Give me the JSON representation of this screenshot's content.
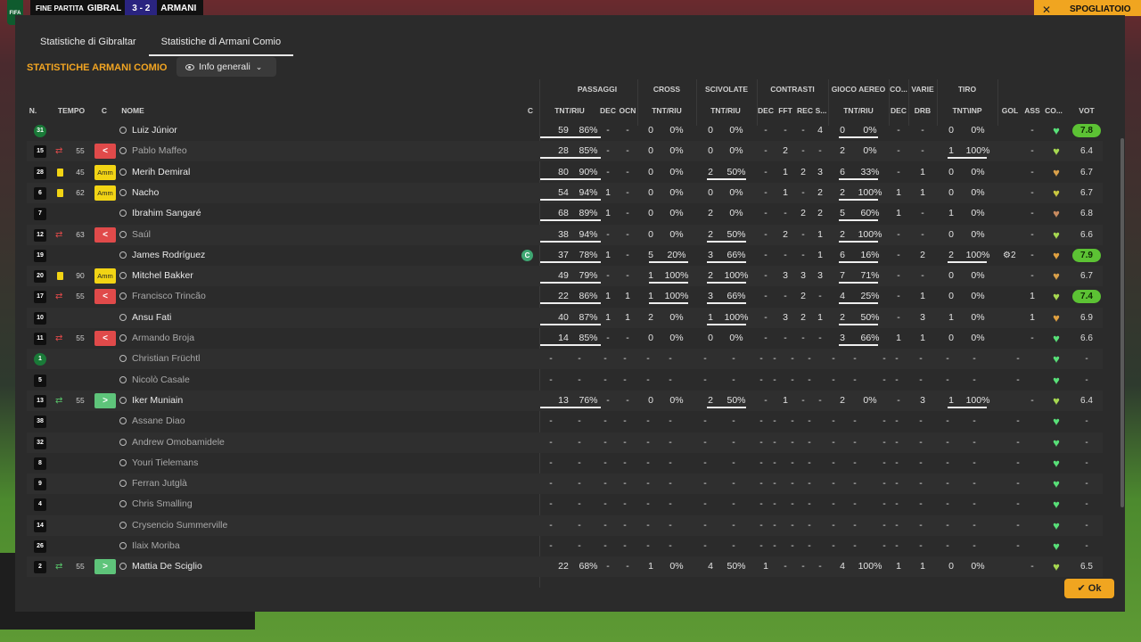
{
  "topbar": {
    "label": "FINE PARTITA",
    "home": "GIBRAL",
    "score": "3 - 2",
    "away": "ARMANI",
    "right": "SPOGLIATOIO",
    "close": "✕",
    "logo": "FIFA"
  },
  "tabs": [
    {
      "label": "Statistiche di Gibraltar"
    },
    {
      "label": "Statistiche di Armani Comio"
    }
  ],
  "team_title": "STATISTICHE ARMANI COMIO",
  "dropdown": {
    "label": "Info generali"
  },
  "groups": [
    "PASSAGGI",
    "CROSS",
    "SCIVOLATE",
    "CONTRASTI",
    "GIOCO AEREO",
    "CO...",
    "VARIE",
    "TIRO"
  ],
  "columns": [
    "N.",
    "TEMPO",
    "C",
    "NOME",
    "C",
    "TNT/RIU",
    "DEC",
    "OCN",
    "TNT/RIU",
    "TNT/RIU",
    "DEC",
    "FFT",
    "REC",
    "S...",
    "TNT/RIU",
    "DEC",
    "DRB",
    "TNT\\INP",
    "GOL",
    "ASS",
    "CO...",
    "VOT"
  ],
  "ok_label": "Ok",
  "colors": {
    "accent": "#f0a520",
    "vote_high": "#5cc234",
    "sub_out": "#e04a4a",
    "sub_in": "#5ec47a",
    "yellow": "#f2d414"
  },
  "players": [
    {
      "n": "31",
      "gk": true,
      "name": "Luiz Júnior",
      "mark": "",
      "min": "",
      "badge": "",
      "p": [
        "59",
        "86%"
      ],
      "pd": "-",
      "po": "-",
      "cr": [
        "0",
        "0%"
      ],
      "sc": [
        "0",
        "0%"
      ],
      "ct": [
        "-",
        "-",
        "-",
        "4"
      ],
      "ae": [
        "0",
        "0%"
      ],
      "co": "-",
      "dr": "-",
      "ti": [
        "0",
        "0%"
      ],
      "gol": "",
      "ass": "-",
      "heart": "#58e078",
      "vote": "7.8",
      "hi": true,
      "sub": false,
      "barp": true,
      "barc": false,
      "bars": false,
      "bara": true,
      "bart": false
    },
    {
      "n": "15",
      "name": "Pablo Maffeo",
      "mark": "out",
      "min": "55",
      "badge": "out",
      "p": [
        "28",
        "85%"
      ],
      "pd": "-",
      "po": "-",
      "cr": [
        "0",
        "0%"
      ],
      "sc": [
        "0",
        "0%"
      ],
      "ct": [
        "-",
        "2",
        "-",
        "-"
      ],
      "ae": [
        "2",
        "0%"
      ],
      "co": "-",
      "dr": "-",
      "ti": [
        "1",
        "100%"
      ],
      "gol": "",
      "ass": "-",
      "heart": "#a6d850",
      "vote": "6.4",
      "hi": false,
      "sub": true,
      "barp": true,
      "barc": false,
      "bars": false,
      "bara": false,
      "bart": true
    },
    {
      "n": "28",
      "name": "Merih Demiral",
      "mark": "yellow",
      "min": "45",
      "badge": "amm",
      "p": [
        "80",
        "90%"
      ],
      "pd": "-",
      "po": "-",
      "cr": [
        "0",
        "0%"
      ],
      "sc": [
        "2",
        "50%"
      ],
      "ct": [
        "-",
        "1",
        "2",
        "3"
      ],
      "ae": [
        "6",
        "33%"
      ],
      "co": "-",
      "dr": "1",
      "ti": [
        "0",
        "0%"
      ],
      "gol": "",
      "ass": "-",
      "heart": "#d9a04a",
      "vote": "6.7",
      "hi": false,
      "sub": false,
      "barp": true,
      "barc": false,
      "bars": true,
      "bara": true,
      "bart": false
    },
    {
      "n": "6",
      "name": "Nacho",
      "mark": "yellow",
      "min": "62",
      "badge": "amm",
      "p": [
        "54",
        "94%"
      ],
      "pd": "1",
      "po": "-",
      "cr": [
        "0",
        "0%"
      ],
      "sc": [
        "0",
        "0%"
      ],
      "ct": [
        "-",
        "1",
        "-",
        "2"
      ],
      "ae": [
        "2",
        "100%"
      ],
      "co": "1",
      "dr": "1",
      "ti": [
        "0",
        "0%"
      ],
      "gol": "",
      "ass": "-",
      "heart": "#c9c840",
      "vote": "6.7",
      "hi": false,
      "sub": false,
      "barp": true,
      "barc": false,
      "bars": false,
      "bara": true,
      "bart": false
    },
    {
      "n": "7",
      "name": "Ibrahim Sangaré",
      "mark": "",
      "min": "",
      "badge": "",
      "p": [
        "68",
        "89%"
      ],
      "pd": "1",
      "po": "-",
      "cr": [
        "0",
        "0%"
      ],
      "sc": [
        "2",
        "0%"
      ],
      "ct": [
        "-",
        "-",
        "2",
        "2"
      ],
      "ae": [
        "5",
        "60%"
      ],
      "co": "1",
      "dr": "-",
      "ti": [
        "1",
        "0%"
      ],
      "gol": "",
      "ass": "-",
      "heart": "#c88a60",
      "vote": "6.8",
      "hi": false,
      "sub": false,
      "barp": true,
      "barc": false,
      "bars": false,
      "bara": true,
      "bart": false
    },
    {
      "n": "12",
      "name": "Saúl",
      "mark": "out",
      "min": "63",
      "badge": "out",
      "p": [
        "38",
        "94%"
      ],
      "pd": "-",
      "po": "-",
      "cr": [
        "0",
        "0%"
      ],
      "sc": [
        "2",
        "50%"
      ],
      "ct": [
        "-",
        "2",
        "-",
        "1"
      ],
      "ae": [
        "2",
        "100%"
      ],
      "co": "-",
      "dr": "-",
      "ti": [
        "0",
        "0%"
      ],
      "gol": "",
      "ass": "-",
      "heart": "#a6d850",
      "vote": "6.6",
      "hi": false,
      "sub": true,
      "barp": true,
      "barc": false,
      "bars": true,
      "bara": true,
      "bart": false
    },
    {
      "n": "19",
      "name": "James Rodríguez",
      "mark": "",
      "min": "",
      "badge": "",
      "capt": "C",
      "p": [
        "37",
        "78%"
      ],
      "pd": "1",
      "po": "-",
      "cr": [
        "5",
        "20%"
      ],
      "sc": [
        "3",
        "66%"
      ],
      "ct": [
        "-",
        "-",
        "-",
        "1"
      ],
      "ae": [
        "6",
        "16%"
      ],
      "co": "-",
      "dr": "2",
      "ti": [
        "2",
        "100%"
      ],
      "gol": "⚙2",
      "ass": "-",
      "heart": "#e0a040",
      "vote": "7.9",
      "hi": true,
      "sub": false,
      "barp": true,
      "barc": true,
      "bars": true,
      "bara": true,
      "bart": true
    },
    {
      "n": "20",
      "name": "Mitchel Bakker",
      "mark": "yellow",
      "min": "90",
      "badge": "amm",
      "p": [
        "49",
        "79%"
      ],
      "pd": "-",
      "po": "-",
      "cr": [
        "1",
        "100%"
      ],
      "sc": [
        "2",
        "100%"
      ],
      "ct": [
        "-",
        "3",
        "3",
        "3"
      ],
      "ae": [
        "7",
        "71%"
      ],
      "co": "-",
      "dr": "-",
      "ti": [
        "0",
        "0%"
      ],
      "gol": "",
      "ass": "-",
      "heart": "#d9a04a",
      "vote": "6.7",
      "hi": false,
      "sub": false,
      "barp": true,
      "barc": true,
      "bars": true,
      "bara": true,
      "bart": false
    },
    {
      "n": "17",
      "name": "Francisco Trincão",
      "mark": "out",
      "min": "55",
      "badge": "out",
      "p": [
        "22",
        "86%"
      ],
      "pd": "1",
      "po": "1",
      "cr": [
        "1",
        "100%"
      ],
      "sc": [
        "3",
        "66%"
      ],
      "ct": [
        "-",
        "-",
        "2",
        "-"
      ],
      "ae": [
        "4",
        "25%"
      ],
      "co": "-",
      "dr": "1",
      "ti": [
        "0",
        "0%"
      ],
      "gol": "",
      "ass": "1",
      "heart": "#a6d850",
      "vote": "7.4",
      "hi": true,
      "sub": true,
      "barp": true,
      "barc": true,
      "bars": true,
      "bara": true,
      "bart": false
    },
    {
      "n": "10",
      "name": "Ansu Fati",
      "mark": "",
      "min": "",
      "badge": "",
      "p": [
        "40",
        "87%"
      ],
      "pd": "1",
      "po": "1",
      "cr": [
        "2",
        "0%"
      ],
      "sc": [
        "1",
        "100%"
      ],
      "ct": [
        "-",
        "3",
        "2",
        "1"
      ],
      "ae": [
        "2",
        "50%"
      ],
      "co": "-",
      "dr": "3",
      "ti": [
        "1",
        "0%"
      ],
      "gol": "",
      "ass": "1",
      "heart": "#e0a040",
      "vote": "6.9",
      "hi": false,
      "sub": false,
      "barp": true,
      "barc": false,
      "bars": true,
      "bara": true,
      "bart": false
    },
    {
      "n": "11",
      "name": "Armando Broja",
      "mark": "out",
      "min": "55",
      "badge": "out",
      "p": [
        "14",
        "85%"
      ],
      "pd": "-",
      "po": "-",
      "cr": [
        "0",
        "0%"
      ],
      "sc": [
        "0",
        "0%"
      ],
      "ct": [
        "-",
        "-",
        "-",
        "-"
      ],
      "ae": [
        "3",
        "66%"
      ],
      "co": "1",
      "dr": "1",
      "ti": [
        "0",
        "0%"
      ],
      "gol": "",
      "ass": "-",
      "heart": "#58e078",
      "vote": "6.6",
      "hi": false,
      "sub": true,
      "barp": true,
      "barc": false,
      "bars": false,
      "bara": true,
      "bart": false
    },
    {
      "n": "1",
      "gk": true,
      "name": "Christian Früchtl",
      "empty": true,
      "sub": true,
      "heart": "#58e078",
      "vote": "-"
    },
    {
      "n": "5",
      "name": "Nicolò Casale",
      "empty": true,
      "sub": true,
      "heart": "#58e078",
      "vote": "-"
    },
    {
      "n": "13",
      "name": "Iker Muniain",
      "mark": "in",
      "min": "55",
      "badge": "in",
      "p": [
        "13",
        "76%"
      ],
      "pd": "-",
      "po": "-",
      "cr": [
        "0",
        "0%"
      ],
      "sc": [
        "2",
        "50%"
      ],
      "ct": [
        "-",
        "1",
        "-",
        "-"
      ],
      "ae": [
        "2",
        "0%"
      ],
      "co": "-",
      "dr": "3",
      "ti": [
        "1",
        "100%"
      ],
      "gol": "",
      "ass": "-",
      "heart": "#a6d850",
      "vote": "6.4",
      "hi": false,
      "sub": false,
      "barp": true,
      "barc": false,
      "bars": true,
      "bara": false,
      "bart": true
    },
    {
      "n": "38",
      "name": "Assane Diao",
      "empty": true,
      "sub": true,
      "heart": "#58e078",
      "vote": "-"
    },
    {
      "n": "32",
      "name": "Andrew Omobamidele",
      "empty": true,
      "sub": true,
      "heart": "#58e078",
      "vote": "-"
    },
    {
      "n": "8",
      "name": "Youri Tielemans",
      "empty": true,
      "sub": true,
      "heart": "#58e078",
      "vote": "-"
    },
    {
      "n": "9",
      "name": "Ferran Jutglà",
      "empty": true,
      "sub": true,
      "heart": "#58e078",
      "vote": "-"
    },
    {
      "n": "4",
      "name": "Chris Smalling",
      "empty": true,
      "sub": true,
      "heart": "#58e078",
      "vote": "-"
    },
    {
      "n": "14",
      "name": "Crysencio Summerville",
      "empty": true,
      "sub": true,
      "heart": "#58e078",
      "vote": "-"
    },
    {
      "n": "26",
      "name": "Ilaix Moriba",
      "empty": true,
      "sub": true,
      "heart": "#58e078",
      "vote": "-"
    },
    {
      "n": "2",
      "name": "Mattia De Sciglio",
      "mark": "in",
      "min": "55",
      "badge": "in",
      "p": [
        "22",
        "68%"
      ],
      "pd": "-",
      "po": "-",
      "cr": [
        "1",
        "0%"
      ],
      "sc": [
        "4",
        "50%"
      ],
      "ct": [
        "1",
        "-",
        "-",
        "-"
      ],
      "ae": [
        "4",
        "100%"
      ],
      "co": "1",
      "dr": "1",
      "ti": [
        "0",
        "0%"
      ],
      "gol": "",
      "ass": "-",
      "heart": "#a6d850",
      "vote": "6.5",
      "hi": false,
      "sub": false,
      "barp": false,
      "barc": false,
      "bars": false,
      "bara": false,
      "bart": false
    }
  ]
}
